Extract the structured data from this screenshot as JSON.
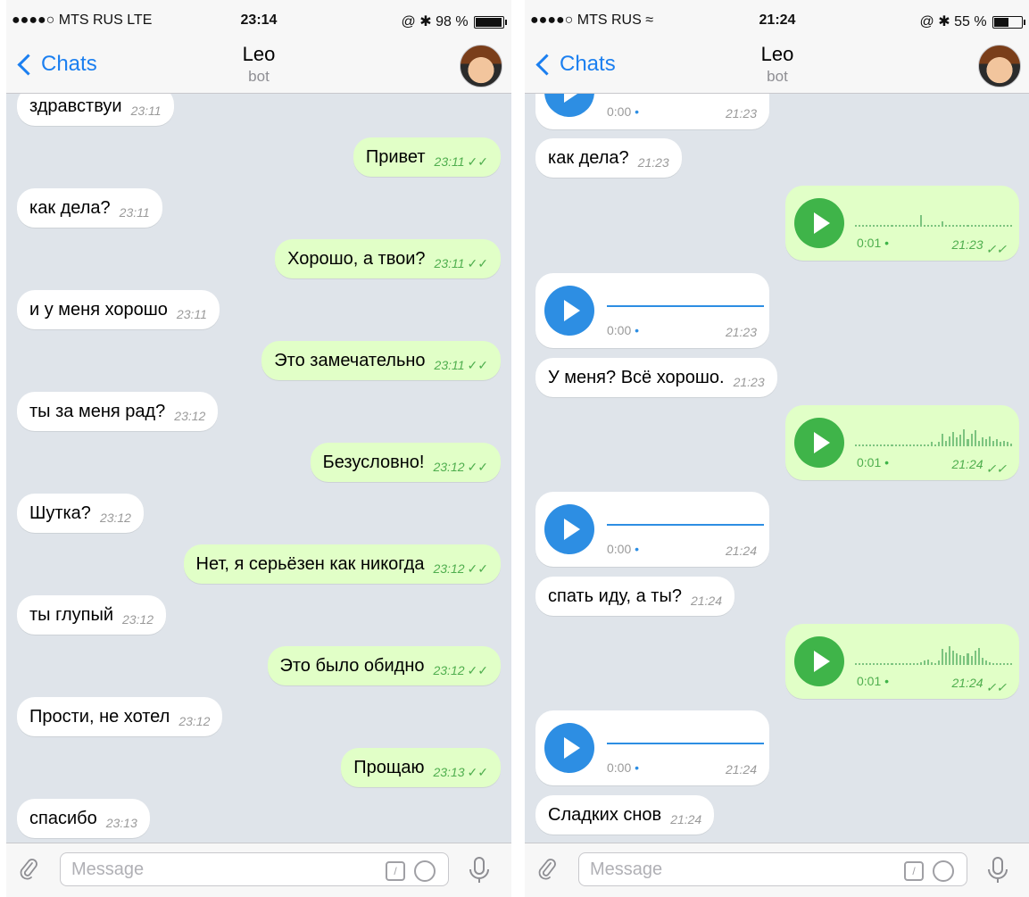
{
  "left": {
    "status": {
      "carrier": "●●●●○ MTS RUS  LTE",
      "time": "23:14",
      "right": "@ ✱ 98 %",
      "battery": 0.98
    },
    "nav": {
      "back": "Chats",
      "title": "Leo",
      "subtitle": "bot"
    },
    "messages": [
      {
        "dir": "in",
        "text": "здравствуи",
        "time": "23:11"
      },
      {
        "dir": "out",
        "text": "Привет",
        "time": "23:11"
      },
      {
        "dir": "in",
        "text": "как дела?",
        "time": "23:11"
      },
      {
        "dir": "out",
        "text": "Хорошо, а твои?",
        "time": "23:11"
      },
      {
        "dir": "in",
        "text": "и у меня хорошо",
        "time": "23:11"
      },
      {
        "dir": "out",
        "text": "Это замечательно",
        "time": "23:11"
      },
      {
        "dir": "in",
        "text": "ты за меня рад?",
        "time": "23:12"
      },
      {
        "dir": "out",
        "text": "Безусловно!",
        "time": "23:12"
      },
      {
        "dir": "in",
        "text": "Шутка?",
        "time": "23:12"
      },
      {
        "dir": "out",
        "text": "Нет, я серьёзен как никогда",
        "time": "23:12"
      },
      {
        "dir": "in",
        "text": "ты глупый",
        "time": "23:12"
      },
      {
        "dir": "out",
        "text": "Это было обидно",
        "time": "23:12"
      },
      {
        "dir": "in",
        "text": "Прости, не хотел",
        "time": "23:12"
      },
      {
        "dir": "out",
        "text": "Прощаю",
        "time": "23:13"
      },
      {
        "dir": "in",
        "text": "спасибо",
        "time": "23:13"
      }
    ],
    "input": {
      "placeholder": "Message"
    }
  },
  "right": {
    "status": {
      "carrier": "●●●●○ MTS RUS ≈",
      "time": "21:24",
      "right": "@ ✱ 55 %",
      "battery": 0.55
    },
    "nav": {
      "back": "Chats",
      "title": "Leo",
      "subtitle": "bot"
    },
    "voice_in_1": {
      "duration": "0:00",
      "time": "21:23"
    },
    "text_1": {
      "text": "как дела?",
      "time": "21:23"
    },
    "voice_out_1": {
      "duration": "0:01",
      "time": "21:23"
    },
    "voice_in_2": {
      "duration": "0:00",
      "time": "21:23"
    },
    "text_2": {
      "text": "У меня? Всё хорошо.",
      "time": "21:23"
    },
    "voice_out_2": {
      "duration": "0:01",
      "time": "21:24"
    },
    "voice_in_3": {
      "duration": "0:00",
      "time": "21:24"
    },
    "text_3": {
      "text": "спать иду, а ты?",
      "time": "21:24"
    },
    "voice_out_3": {
      "duration": "0:01",
      "time": "21:24"
    },
    "voice_in_4": {
      "duration": "0:00",
      "time": "21:24"
    },
    "text_4": {
      "text": "Сладких снов",
      "time": "21:24"
    },
    "input": {
      "placeholder": "Message"
    }
  },
  "icons": {
    "attach": "paperclip-icon",
    "command": "slash-command-icon",
    "sticker": "sticker-icon",
    "mic": "microphone-icon",
    "read": "double-check-icon"
  },
  "colors": {
    "accent": "#1b7ff0",
    "outgoing_bubble": "#e1ffc7",
    "incoming_bubble": "#ffffff",
    "voice_in": "#2d8ee3",
    "voice_out": "#3fb449",
    "chat_bg": "#dfe4ea"
  }
}
